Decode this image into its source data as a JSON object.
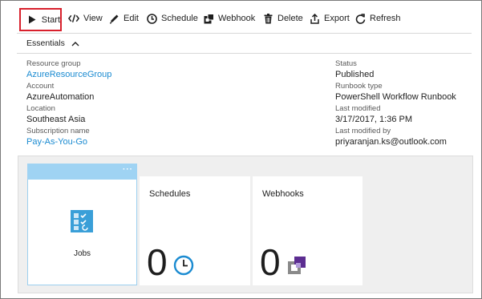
{
  "toolbar": {
    "start": "Start",
    "view": "View",
    "edit": "Edit",
    "schedule": "Schedule",
    "webhook": "Webhook",
    "delete": "Delete",
    "export": "Export",
    "refresh": "Refresh"
  },
  "essentials": {
    "label": "Essentials",
    "left": [
      {
        "label": "Resource group",
        "value": "AzureResourceGroup",
        "link": true
      },
      {
        "label": "Account",
        "value": "AzureAutomation",
        "link": false
      },
      {
        "label": "Location",
        "value": "Southeast Asia",
        "link": false
      },
      {
        "label": "Subscription name",
        "value": "Pay-As-You-Go",
        "link": true
      }
    ],
    "right": [
      {
        "label": "Status",
        "value": "Published"
      },
      {
        "label": "Runbook type",
        "value": "PowerShell Workflow Runbook"
      },
      {
        "label": "Last modified",
        "value": "3/17/2017, 1:36 PM"
      },
      {
        "label": "Last modified by",
        "value": "priyaranjan.ks@outlook.com"
      }
    ]
  },
  "tiles": {
    "jobs": {
      "label": "Jobs",
      "menu": "···"
    },
    "schedules": {
      "title": "Schedules",
      "count": "0"
    },
    "webhooks": {
      "title": "Webhooks",
      "count": "0"
    }
  },
  "colors": {
    "link": "#1b8bd1",
    "highlight_border": "#d8202c",
    "tile_header": "#9fd3f3"
  }
}
